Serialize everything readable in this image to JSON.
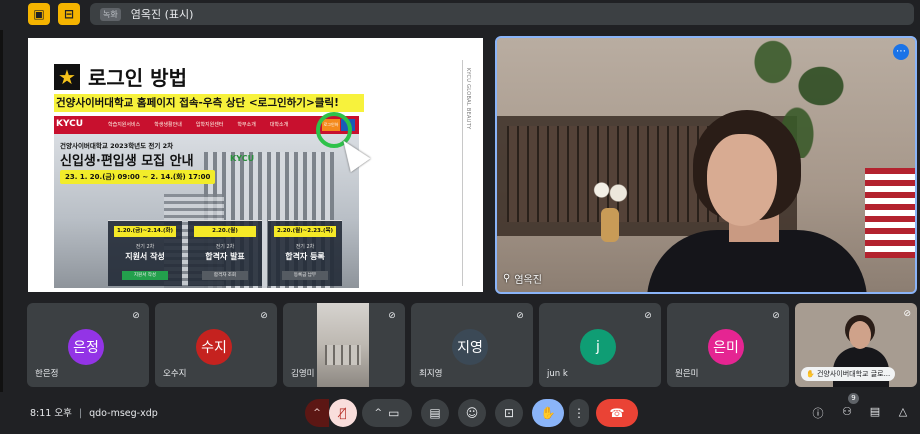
{
  "top_bar": {
    "left_icon_1": "presentation-off-icon",
    "left_icon_2": "pin-icon",
    "presenter_badge": "녹화",
    "presenter_name": "염옥진 (표시)"
  },
  "slide": {
    "title": "로그인 방법",
    "subtitle": "건양사이버대학교 홈페이지 접속-우측 상단 <로그인하기>클릭!",
    "side_text": "KYCU GLOBAL BEAUTY",
    "site_logo": "KYCU",
    "nav_items": [
      "학습지원서비스",
      "학생생활안내",
      "입학지원센터",
      "학부소개",
      "대학소개"
    ],
    "login_label": "로그인하기",
    "campaign_small": "건양사이버대학교 2023학년도 전기 2차",
    "campaign_big": "신입생·편입생 모집 안내",
    "campaign_dates": "23. 1. 20.(금) 09:00 ~ 2. 14.(화) 17:00",
    "building_sign": "KYCU",
    "steps": [
      {
        "date": "1.20.(금)~2.14.(화)",
        "small": "전기 2차",
        "big": "지원서 작성",
        "tag": "지원서 작성"
      },
      {
        "date": "2.20.(월)",
        "small": "전기 2차",
        "big": "합격자 발표",
        "tag": "합격자 조회"
      },
      {
        "date": "2.20.(월)~2.23.(목)",
        "small": "전기 2차",
        "big": "합격자 등록",
        "tag": "등록금 납부"
      }
    ]
  },
  "main_video": {
    "name": "염옥진",
    "more_icon": "more-options-icon"
  },
  "participants": [
    {
      "name": "한은정",
      "avatar": "은정",
      "color": "#9334e6",
      "muted": true
    },
    {
      "name": "오수지",
      "avatar": "수지",
      "color": "#d93025",
      "muted": true
    },
    {
      "name": "김영미",
      "avatar": "",
      "color": "",
      "muted": true
    },
    {
      "name": "최지영",
      "avatar": "지영",
      "color": "#3c4a5a",
      "muted": true
    },
    {
      "name": "jun k",
      "avatar": "j",
      "color": "#12a57a",
      "muted": true
    },
    {
      "name": "원은미",
      "avatar": "은미",
      "color": "#e52592",
      "muted": true
    },
    {
      "name": "건양사이버대학교 글로...",
      "avatar": "",
      "color": "",
      "muted": true
    }
  ],
  "bottom_bar": {
    "time": "8:11 오후",
    "separator": "|",
    "meeting_code": "qdo-mseg-xdp",
    "participant_count": "9"
  }
}
